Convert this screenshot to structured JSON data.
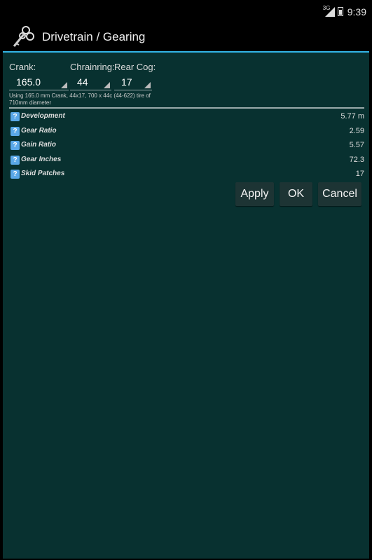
{
  "status": {
    "network": "3G",
    "time": "9:39"
  },
  "app": {
    "title": "Drivetrain / Gearing"
  },
  "form": {
    "crank_label": "Crank:",
    "chainring_label": "Chrainring:",
    "cog_label": "Rear Cog:",
    "crank_value": "165.0",
    "chainring_value": "44",
    "cog_value": "17",
    "note": "Using 165.0 mm Crank, 44x17, 700 x 44c (44-622) tire of 710mm diameter"
  },
  "results": [
    {
      "name": "Development",
      "value": "5.77 m"
    },
    {
      "name": "Gear Ratio",
      "value": "2.59"
    },
    {
      "name": "Gain Ratio",
      "value": "5.57"
    },
    {
      "name": "Gear Inches",
      "value": "72.3"
    },
    {
      "name": "Skid Patches",
      "value": "17"
    }
  ],
  "help_glyph": "?",
  "buttons": {
    "apply": "Apply",
    "ok": "OK",
    "cancel": "Cancel"
  },
  "colors": {
    "background": "#083130",
    "accent": "#33b5e5",
    "help_icon": "#5aa8e8"
  }
}
